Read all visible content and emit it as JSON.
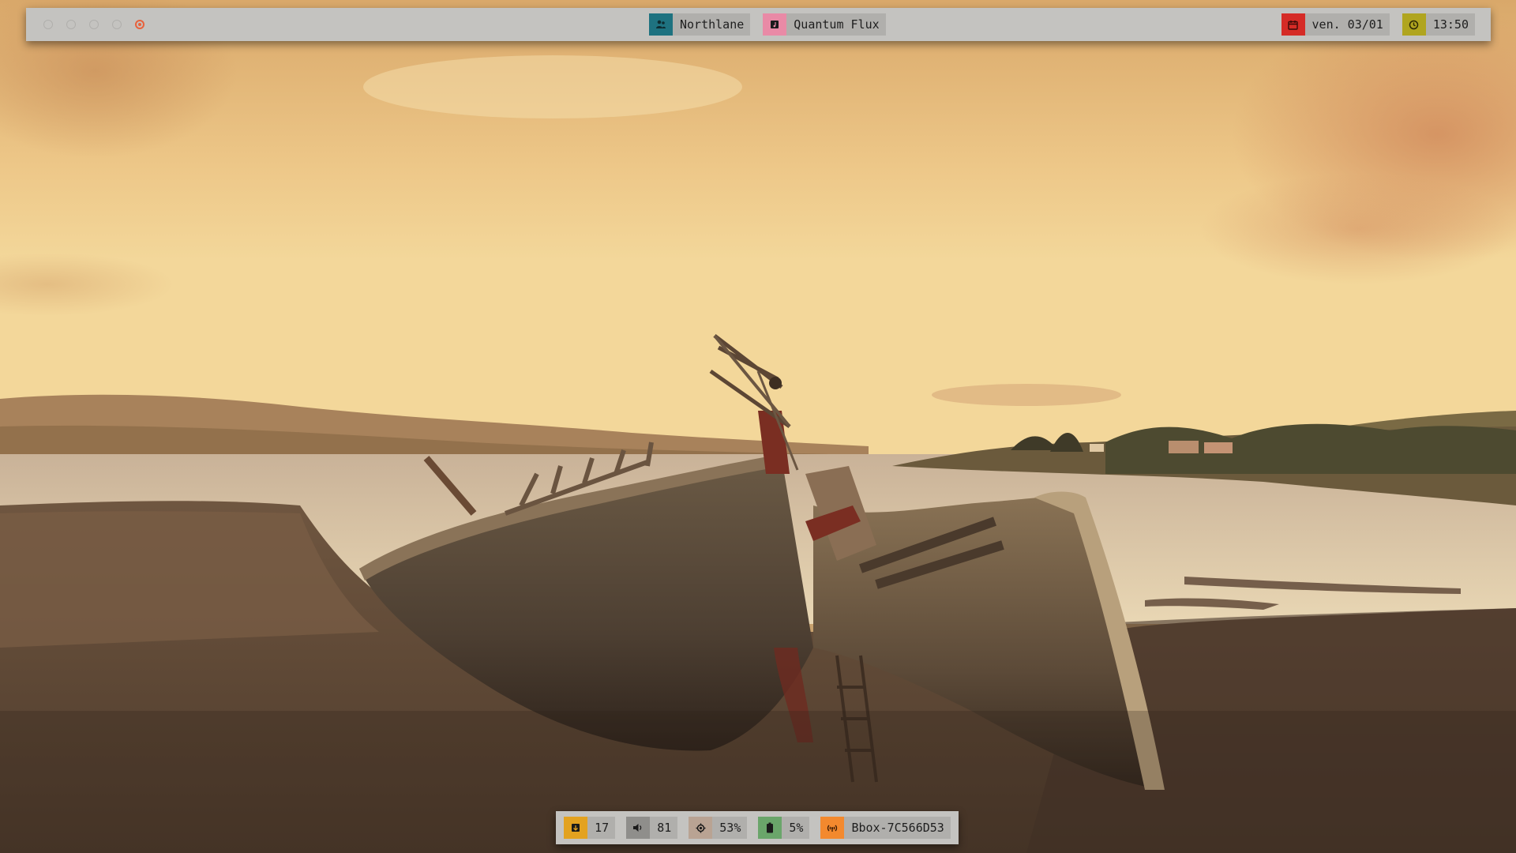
{
  "workspaces": [
    {
      "icon": "circle",
      "active": false
    },
    {
      "icon": "circle",
      "active": false
    },
    {
      "icon": "circle",
      "active": false
    },
    {
      "icon": "circle",
      "active": false
    },
    {
      "icon": "circle-dot",
      "active": true
    }
  ],
  "top_center": {
    "user": {
      "icon": "users-icon",
      "label": "Northlane"
    },
    "music": {
      "icon": "music-note-icon",
      "label": "Quantum Flux"
    }
  },
  "top_right": {
    "date": {
      "icon": "calendar-icon",
      "label": "ven. 03/01"
    },
    "clock": {
      "icon": "clock-icon",
      "label": "13:50"
    }
  },
  "bottom": {
    "updates": {
      "icon": "package-icon",
      "label": "17"
    },
    "volume": {
      "icon": "speaker-icon",
      "label": "81"
    },
    "cpu": {
      "icon": "cpu-icon",
      "label": "53%"
    },
    "battery": {
      "icon": "battery-icon",
      "label": "5%"
    },
    "wifi": {
      "icon": "wifi-icon",
      "label": "Bbox-7C566D53"
    }
  },
  "colors": {
    "bar_bg": "#c4c3c0",
    "module_bg": "#b0afac",
    "active_workspace": "#e8623c",
    "user": "#1e7280",
    "music": "#e98aa6",
    "date": "#d52b26",
    "clock": "#b0a51f",
    "updates": "#e3a220",
    "volume": "#8f8e8b",
    "cpu": "#b9a393",
    "battery": "#6aa56a",
    "wifi": "#f3892e"
  }
}
